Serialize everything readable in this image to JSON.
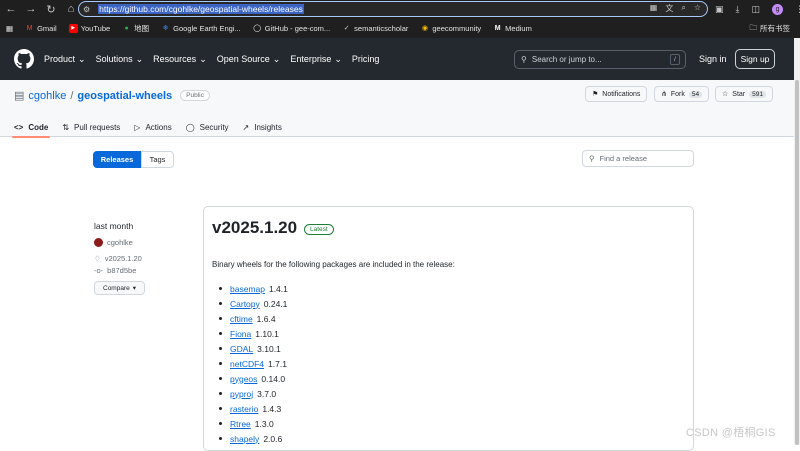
{
  "browser": {
    "url": "https://github.com/cgohlke/geospatial-wheels/releases",
    "bookmarks": [
      "Gmail",
      "YouTube",
      "地图",
      "Google Earth Engi...",
      "GitHub - gee-com...",
      "semanticscholar",
      "geecommunity",
      "Medium"
    ],
    "bookmarks_folder": "所有书签",
    "avatar_letter": "g"
  },
  "header": {
    "menu": [
      "Product",
      "Solutions",
      "Resources",
      "Open Source",
      "Enterprise",
      "Pricing"
    ],
    "search_placeholder": "Search or jump to...",
    "search_key": "/",
    "sign_in": "Sign in",
    "sign_up": "Sign up"
  },
  "repo": {
    "owner": "cgohlke",
    "separator": "/",
    "name": "geospatial-wheels",
    "visibility": "Public",
    "notifications": "Notifications",
    "fork_label": "Fork",
    "fork_count": "54",
    "star_label": "Star",
    "star_count": "591",
    "tabs": [
      "Code",
      "Pull requests",
      "Actions",
      "Security",
      "Insights"
    ]
  },
  "releases_page": {
    "releases_btn": "Releases",
    "tags_btn": "Tags",
    "find_placeholder": "Find a release"
  },
  "release": {
    "date": "last month",
    "author": "cgohlke",
    "tag": "v2025.1.20",
    "commit": "b87d5be",
    "compare": "Compare",
    "title": "v2025.1.20",
    "latest_badge": "Latest",
    "intro": "Binary wheels for the following packages are included in the release:",
    "packages": [
      {
        "name": "basemap",
        "version": "1.4.1"
      },
      {
        "name": "Cartopy",
        "version": "0.24.1"
      },
      {
        "name": "cftime",
        "version": "1.6.4"
      },
      {
        "name": "Fiona",
        "version": "1.10.1"
      },
      {
        "name": "GDAL",
        "version": "3.10.1"
      },
      {
        "name": "netCDF4",
        "version": "1.7.1"
      },
      {
        "name": "pygeos",
        "version": "0.14.0"
      },
      {
        "name": "pyproj",
        "version": "3.7.0"
      },
      {
        "name": "rasterio",
        "version": "1.4.3"
      },
      {
        "name": "Rtree",
        "version": "1.3.0"
      },
      {
        "name": "shapely",
        "version": "2.0.6"
      }
    ]
  },
  "watermark": "CSDN @梧桐GIS"
}
